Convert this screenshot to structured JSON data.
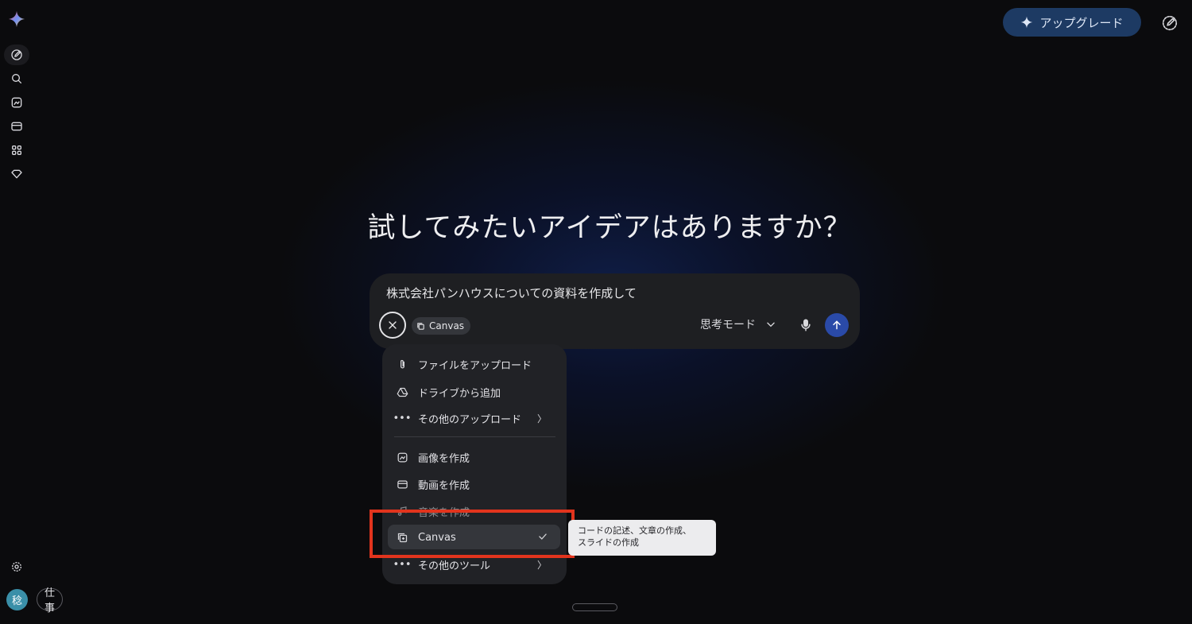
{
  "app": {
    "accent": "#2a4aa8",
    "upgrade_bg": "#1d3a63"
  },
  "sidebar": {
    "icons": [
      "gemini-logo-icon",
      "new-chat-icon",
      "search-icon",
      "image-icon",
      "video-icon",
      "apps-icon",
      "gem-icon"
    ],
    "settings_icon": "gear-icon",
    "avatar_initial": "稔",
    "workspace_label": "仕事"
  },
  "header": {
    "upgrade_label": "アップグレード"
  },
  "main": {
    "headline": "試してみたいアイデアはありますか？"
  },
  "prompt": {
    "value": "株式会社パンハウスについての資料を作成して",
    "tool_chip_label": "Canvas",
    "mode_label": "思考モード"
  },
  "menu": {
    "upload_file": "ファイルをアップロード",
    "add_from_drive": "ドライブから追加",
    "other_uploads": "その他のアップロード",
    "create_image": "画像を作成",
    "create_video": "動画を作成",
    "create_music": "音楽を作成",
    "canvas": "Canvas",
    "other_tools": "その他のツール"
  },
  "tooltip": {
    "line1": "コードの記述、文章の作成、",
    "line2": "スライドの作成"
  }
}
